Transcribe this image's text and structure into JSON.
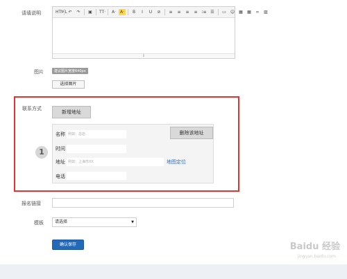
{
  "description": {
    "label": "请填说明"
  },
  "editor": {
    "toolbar": [
      "HTML",
      "↶",
      "↷",
      "▣",
      "TT·",
      "A·",
      "A·",
      "B",
      "I",
      "U",
      "⊘",
      "≡",
      "≡",
      "≡",
      "≡",
      "⁝≡",
      "☰",
      "▭",
      "☺",
      "▦",
      "▦",
      "∞",
      "▨"
    ],
    "resize_glyph": "⇕"
  },
  "image": {
    "label": "图片",
    "size_hint": "建议图片宽度640px",
    "select_button": "选择图片"
  },
  "contact": {
    "label": "联系方式",
    "add_button": "新增地址",
    "step_number": "1",
    "delete_button": "删除该地址",
    "fields": {
      "name_label": "名称",
      "name_placeholder": "例如：总店",
      "time_label": "时间",
      "address_label": "地址",
      "address_placeholder": "例如：上海市XX",
      "map_link": "地图定位",
      "phone_label": "电话"
    }
  },
  "signup": {
    "label": "报名链接"
  },
  "template": {
    "label": "模板",
    "selected": "请选择",
    "arrow": "▼"
  },
  "save_button": "确认保存",
  "watermark": {
    "brand": "Baidu 经验",
    "url": "jingyan.baidu.com"
  }
}
